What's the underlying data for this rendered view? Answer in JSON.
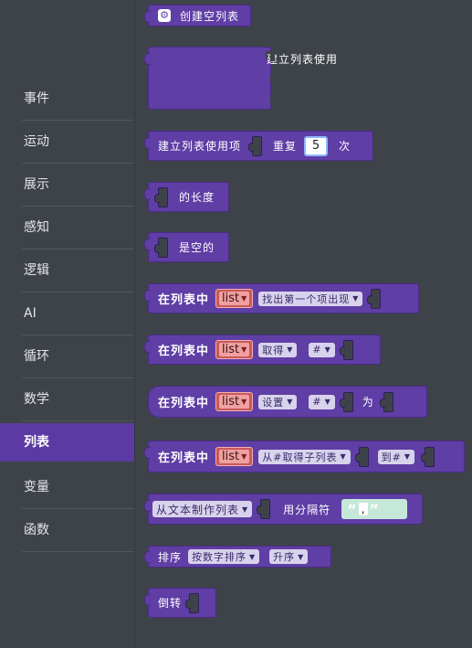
{
  "sidebar": {
    "categories": [
      {
        "label": "事件"
      },
      {
        "label": "运动"
      },
      {
        "label": "展示"
      },
      {
        "label": "感知"
      },
      {
        "label": "逻辑"
      },
      {
        "label": "AI"
      },
      {
        "label": "循环"
      },
      {
        "label": "数学"
      },
      {
        "label": "列表",
        "selected": true
      },
      {
        "label": "变量"
      },
      {
        "label": "函数"
      }
    ]
  },
  "blocks": {
    "create_empty": {
      "label": "创建空列表"
    },
    "create_with": {
      "label": "建立列表使用"
    },
    "repeat": {
      "label": "建立列表使用项",
      "repeat_label": "重复",
      "value": "5",
      "times_label": "次"
    },
    "length": {
      "label": "的长度"
    },
    "is_empty": {
      "label": "是空的"
    },
    "index_of": {
      "in_list": "在列表中",
      "var": "list",
      "mode": "找出第一个项出现"
    },
    "get": {
      "in_list": "在列表中",
      "var": "list",
      "mode": "取得",
      "where": "#"
    },
    "set": {
      "in_list": "在列表中",
      "var": "list",
      "mode": "设置",
      "where": "#",
      "to_label": "为"
    },
    "sublist": {
      "in_list": "在列表中",
      "var": "list",
      "mode": "从#取得子列表",
      "to_label": "到#"
    },
    "split": {
      "mode": "从文本制作列表",
      "delim_label": "用分隔符",
      "delim_value": ","
    },
    "sort": {
      "label": "排序",
      "kind": "按数字排序",
      "order": "升序"
    },
    "reverse": {
      "label": "倒转"
    }
  },
  "colors": {
    "list_block": "#5f3ea5",
    "sidebar_bg": "#3e4349",
    "selected_category": "#5b3aa3",
    "variable": "#c85a5a"
  }
}
